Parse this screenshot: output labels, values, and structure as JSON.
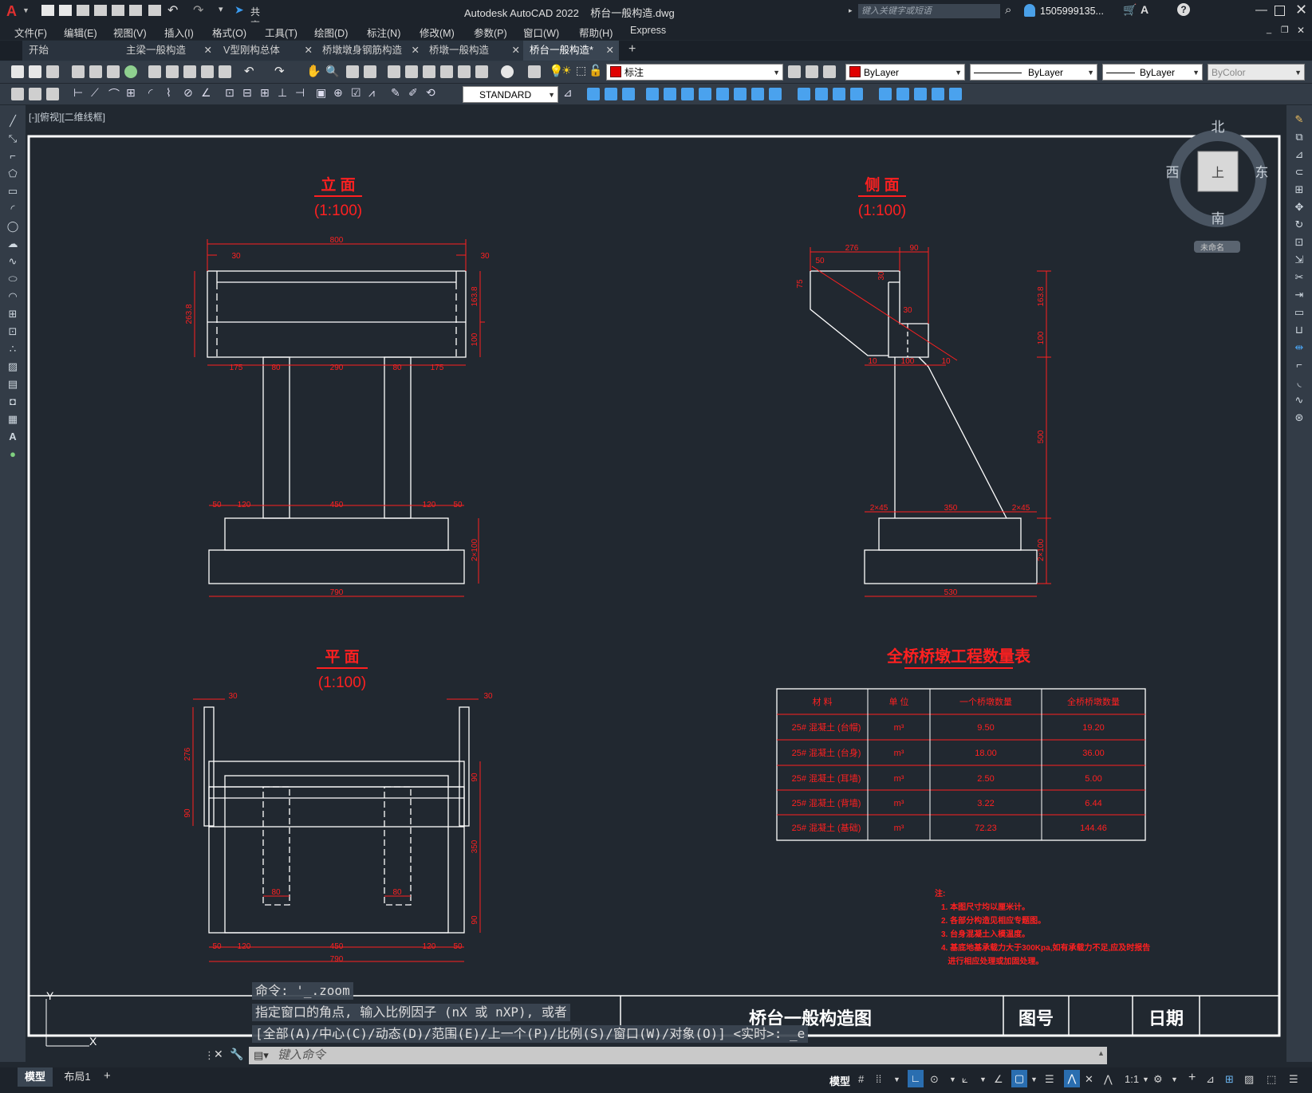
{
  "app": {
    "title": "Autodesk AutoCAD 2022    桥台一般构造.dwg",
    "search_placeholder": "键入关键字或短语",
    "user": "1505999135...",
    "share_label": "共享"
  },
  "menu": [
    "文件(F)",
    "编辑(E)",
    "视图(V)",
    "插入(I)",
    "格式(O)",
    "工具(T)",
    "绘图(D)",
    "标注(N)",
    "修改(M)",
    "参数(P)",
    "窗口(W)",
    "帮助(H)",
    "Express"
  ],
  "tabs": [
    {
      "label": "开始",
      "closable": false
    },
    {
      "label": "主梁一般构造",
      "closable": true
    },
    {
      "label": "V型刚构总体",
      "closable": true
    },
    {
      "label": "桥墩墩身钢筋构造",
      "closable": true
    },
    {
      "label": "桥墩一般构造",
      "closable": true
    },
    {
      "label": "桥台一般构造*",
      "closable": true,
      "active": true
    }
  ],
  "toolbar": {
    "layer": "标注",
    "color": "ByLayer",
    "linetype": "ByLayer",
    "lineweight": "ByLayer",
    "plotstyle": "ByColor",
    "textstyle": "STANDARD"
  },
  "viewport": {
    "label": "[-][俯视][二维线框]",
    "viewcube": {
      "north": "北",
      "south": "南",
      "east": "东",
      "west": "西",
      "face": "上",
      "ucs": "未命名"
    }
  },
  "drawing": {
    "elevation_title": "立  面",
    "side_title": "侧  面",
    "plan_title": "平  面",
    "scale": "(1:100)",
    "elev_dims": {
      "top": "800",
      "t30a": "30",
      "t30b": "30",
      "left_h": "263.8",
      "r1": "163.8",
      "r2": "100",
      "c1": "175",
      "c2": "80",
      "c3": "290",
      "c4": "80",
      "c5": "175",
      "b1": "50",
      "b2": "120",
      "b3": "450",
      "b4": "120",
      "b5": "50",
      "foot": "2×100",
      "bottom": "790"
    },
    "side_dims": {
      "top1": "276",
      "top2": "90",
      "d50": "50",
      "d75": "75",
      "d30a": "30",
      "d30b": "30",
      "r1": "163.8",
      "r2": "100",
      "r3": "500",
      "r4": "2×100",
      "m1": "10",
      "m2": "100",
      "m3": "10",
      "b1": "2×45",
      "b2": "350",
      "b3": "2×45",
      "bottom": "530"
    },
    "plan_dims": {
      "t30a": "30",
      "t30b": "30",
      "l1": "276",
      "l2": "90",
      "r1": "90",
      "r2": "350",
      "r3": "90",
      "c80a": "80",
      "c80b": "80",
      "b1": "50",
      "b2": "120",
      "b3": "450",
      "b4": "120",
      "b5": "50",
      "bottom": "790"
    },
    "table": {
      "title": "全桥桥墩工程数量表",
      "headers": [
        "材  料",
        "单  位",
        "一个桥墩数量",
        "全桥桥墩数量"
      ],
      "rows": [
        [
          "25# 混凝土 (台帽)",
          "m³",
          "9.50",
          "19.20"
        ],
        [
          "25# 混凝土 (台身)",
          "m³",
          "18.00",
          "36.00"
        ],
        [
          "25# 混凝土 (耳墙)",
          "m³",
          "2.50",
          "5.00"
        ],
        [
          "25# 混凝土 (背墙)",
          "m³",
          "3.22",
          "6.44"
        ],
        [
          "25# 混凝土 (基础)",
          "m³",
          "72.23",
          "144.46"
        ]
      ]
    },
    "notes": {
      "head": "注:",
      "items": [
        "1. 本图尺寸均以厘米计。",
        "2. 各部分构造见相应专题图。",
        "3. 台身混凝土入模温度。",
        "4. 基底地基承载力大于300Kpa,如有承载力不足,应及时报告",
        "   进行相应处理或加固处理。"
      ]
    },
    "titleblock": {
      "name": "桥台一般构造图",
      "drawing_no": "图号",
      "date": "日期"
    }
  },
  "command": {
    "history": [
      "命令: '_.zoom",
      "指定窗口的角点, 输入比例因子 (nX 或 nXP), 或者",
      "[全部(A)/中心(C)/动态(D)/范围(E)/上一个(P)/比例(S)/窗口(W)/对象(O)] <实时>: _e"
    ],
    "input_placeholder": "键入命令"
  },
  "status": {
    "layout_tabs": [
      "模型",
      "布局1"
    ],
    "model_label": "模型",
    "scale": "1:1"
  },
  "colors": {
    "cad_red": "#ff2020",
    "cad_white": "#ffffff",
    "bg": "#212830",
    "accent": "#2aa5ff"
  }
}
